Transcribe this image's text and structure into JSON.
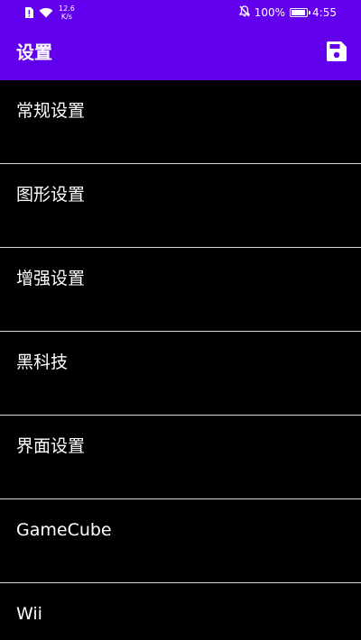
{
  "status_bar": {
    "net_speed_value": "12.6",
    "net_speed_unit": "K/s",
    "battery_percent": "100%",
    "battery_level": 1.0,
    "time": "4:55",
    "icons": [
      "notification-icon",
      "wifi-icon",
      "mute-icon",
      "battery-icon"
    ]
  },
  "app_bar": {
    "title": "设置",
    "action_icon": "save-icon",
    "background": "#6200ee"
  },
  "menu": {
    "items": [
      {
        "label": "常规设置"
      },
      {
        "label": "图形设置"
      },
      {
        "label": "增强设置"
      },
      {
        "label": "黑科技"
      },
      {
        "label": "界面设置"
      },
      {
        "label": "GameCube"
      },
      {
        "label": "Wii"
      }
    ]
  },
  "colors": {
    "accent": "#6200ee",
    "background": "#000000",
    "divider": "#d9d9d9",
    "text": "#ffffff"
  }
}
